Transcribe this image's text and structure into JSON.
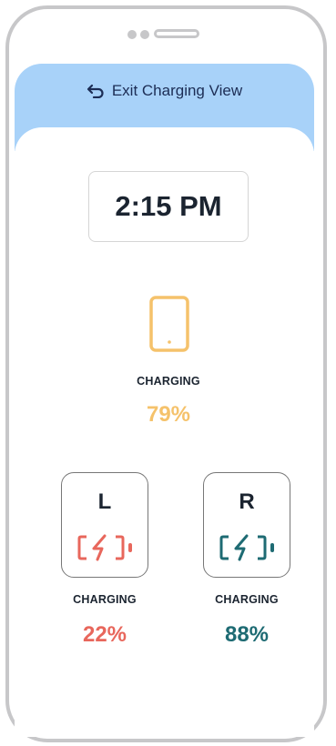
{
  "header": {
    "exit_label": "Exit Charging View"
  },
  "clock": {
    "time": "2:15 PM"
  },
  "device": {
    "status": "CHARGING",
    "percent": "79%",
    "color": "#f5c26b"
  },
  "left_bud": {
    "letter": "L",
    "status": "CHARGING",
    "percent": "22%",
    "color": "#e8675c"
  },
  "right_bud": {
    "letter": "R",
    "status": "CHARGING",
    "percent": "88%",
    "color": "#1e6b73"
  },
  "icons": [
    "undo-arrow-icon",
    "phone-outline-icon",
    "battery-charging-icon"
  ]
}
